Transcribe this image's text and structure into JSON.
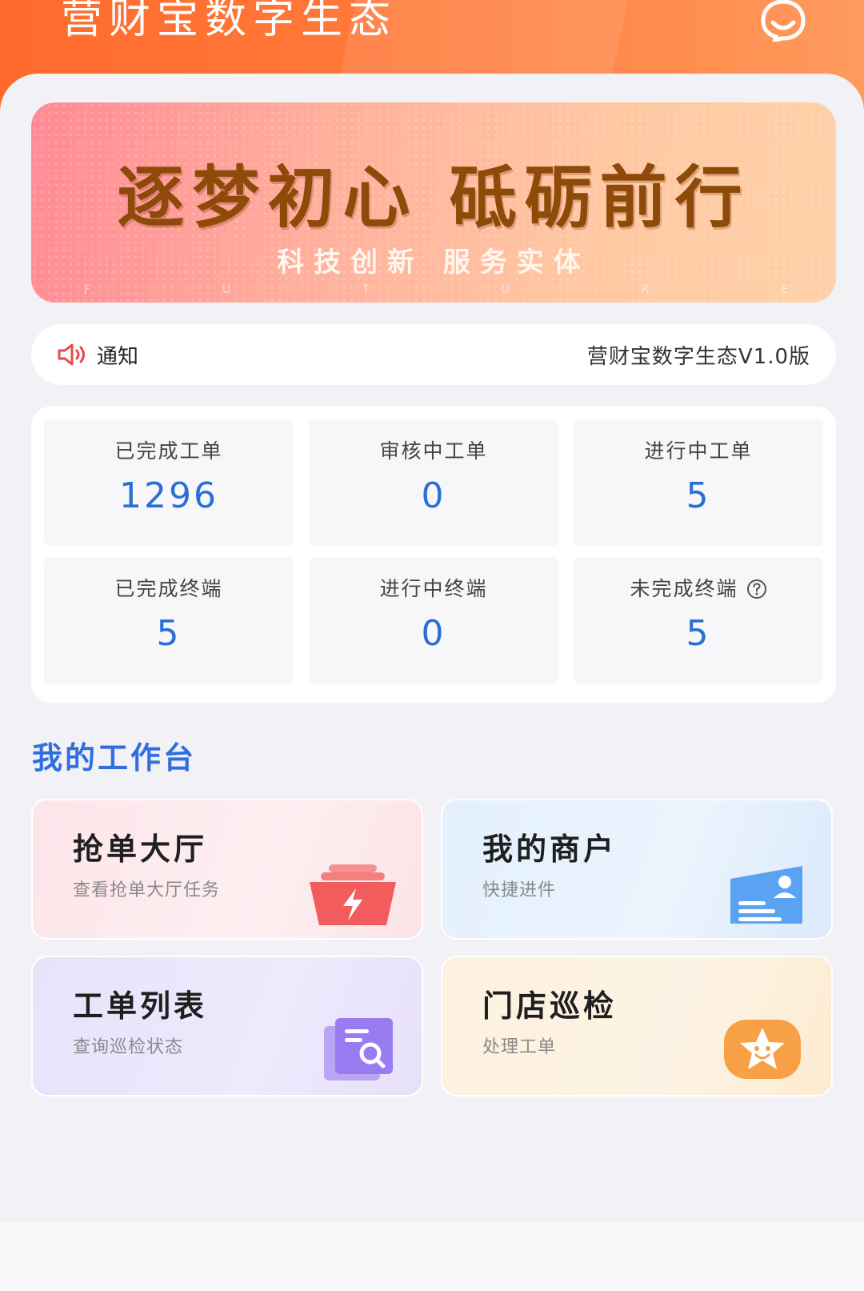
{
  "header": {
    "title": "营财宝数字生态",
    "service_icon": "customer-service-icon",
    "colors": {
      "primary": "#ff6a2c"
    }
  },
  "banner": {
    "title": "逐梦初心 砥砺前行",
    "subtitle": "科技创新  服务实体",
    "letters": [
      "F",
      "U",
      "T",
      "U",
      "R",
      "E"
    ]
  },
  "notice": {
    "icon": "speaker-icon",
    "label": "通知",
    "text": "营财宝数字生态V1.0版"
  },
  "stats": [
    {
      "label": "已完成工单",
      "value": "1296"
    },
    {
      "label": "审核中工单",
      "value": "0"
    },
    {
      "label": "进行中工单",
      "value": "5"
    },
    {
      "label": "已完成终端",
      "value": "5"
    },
    {
      "label": "进行中终端",
      "value": "0"
    },
    {
      "label": "未完成终端",
      "value": "5",
      "icon": "help-icon"
    }
  ],
  "workbench": {
    "title": "我的工作台",
    "tiles": [
      {
        "title": "抢单大厅",
        "subtitle": "查看抢单大厅任务",
        "icon": "lightning-basket-icon"
      },
      {
        "title": "我的商户",
        "subtitle": "快捷进件",
        "icon": "merchant-card-icon"
      },
      {
        "title": "工单列表",
        "subtitle": "查询巡检状态",
        "icon": "document-search-icon"
      },
      {
        "title": "门店巡检",
        "subtitle": "处理工单",
        "icon": "star-smile-icon"
      }
    ]
  }
}
